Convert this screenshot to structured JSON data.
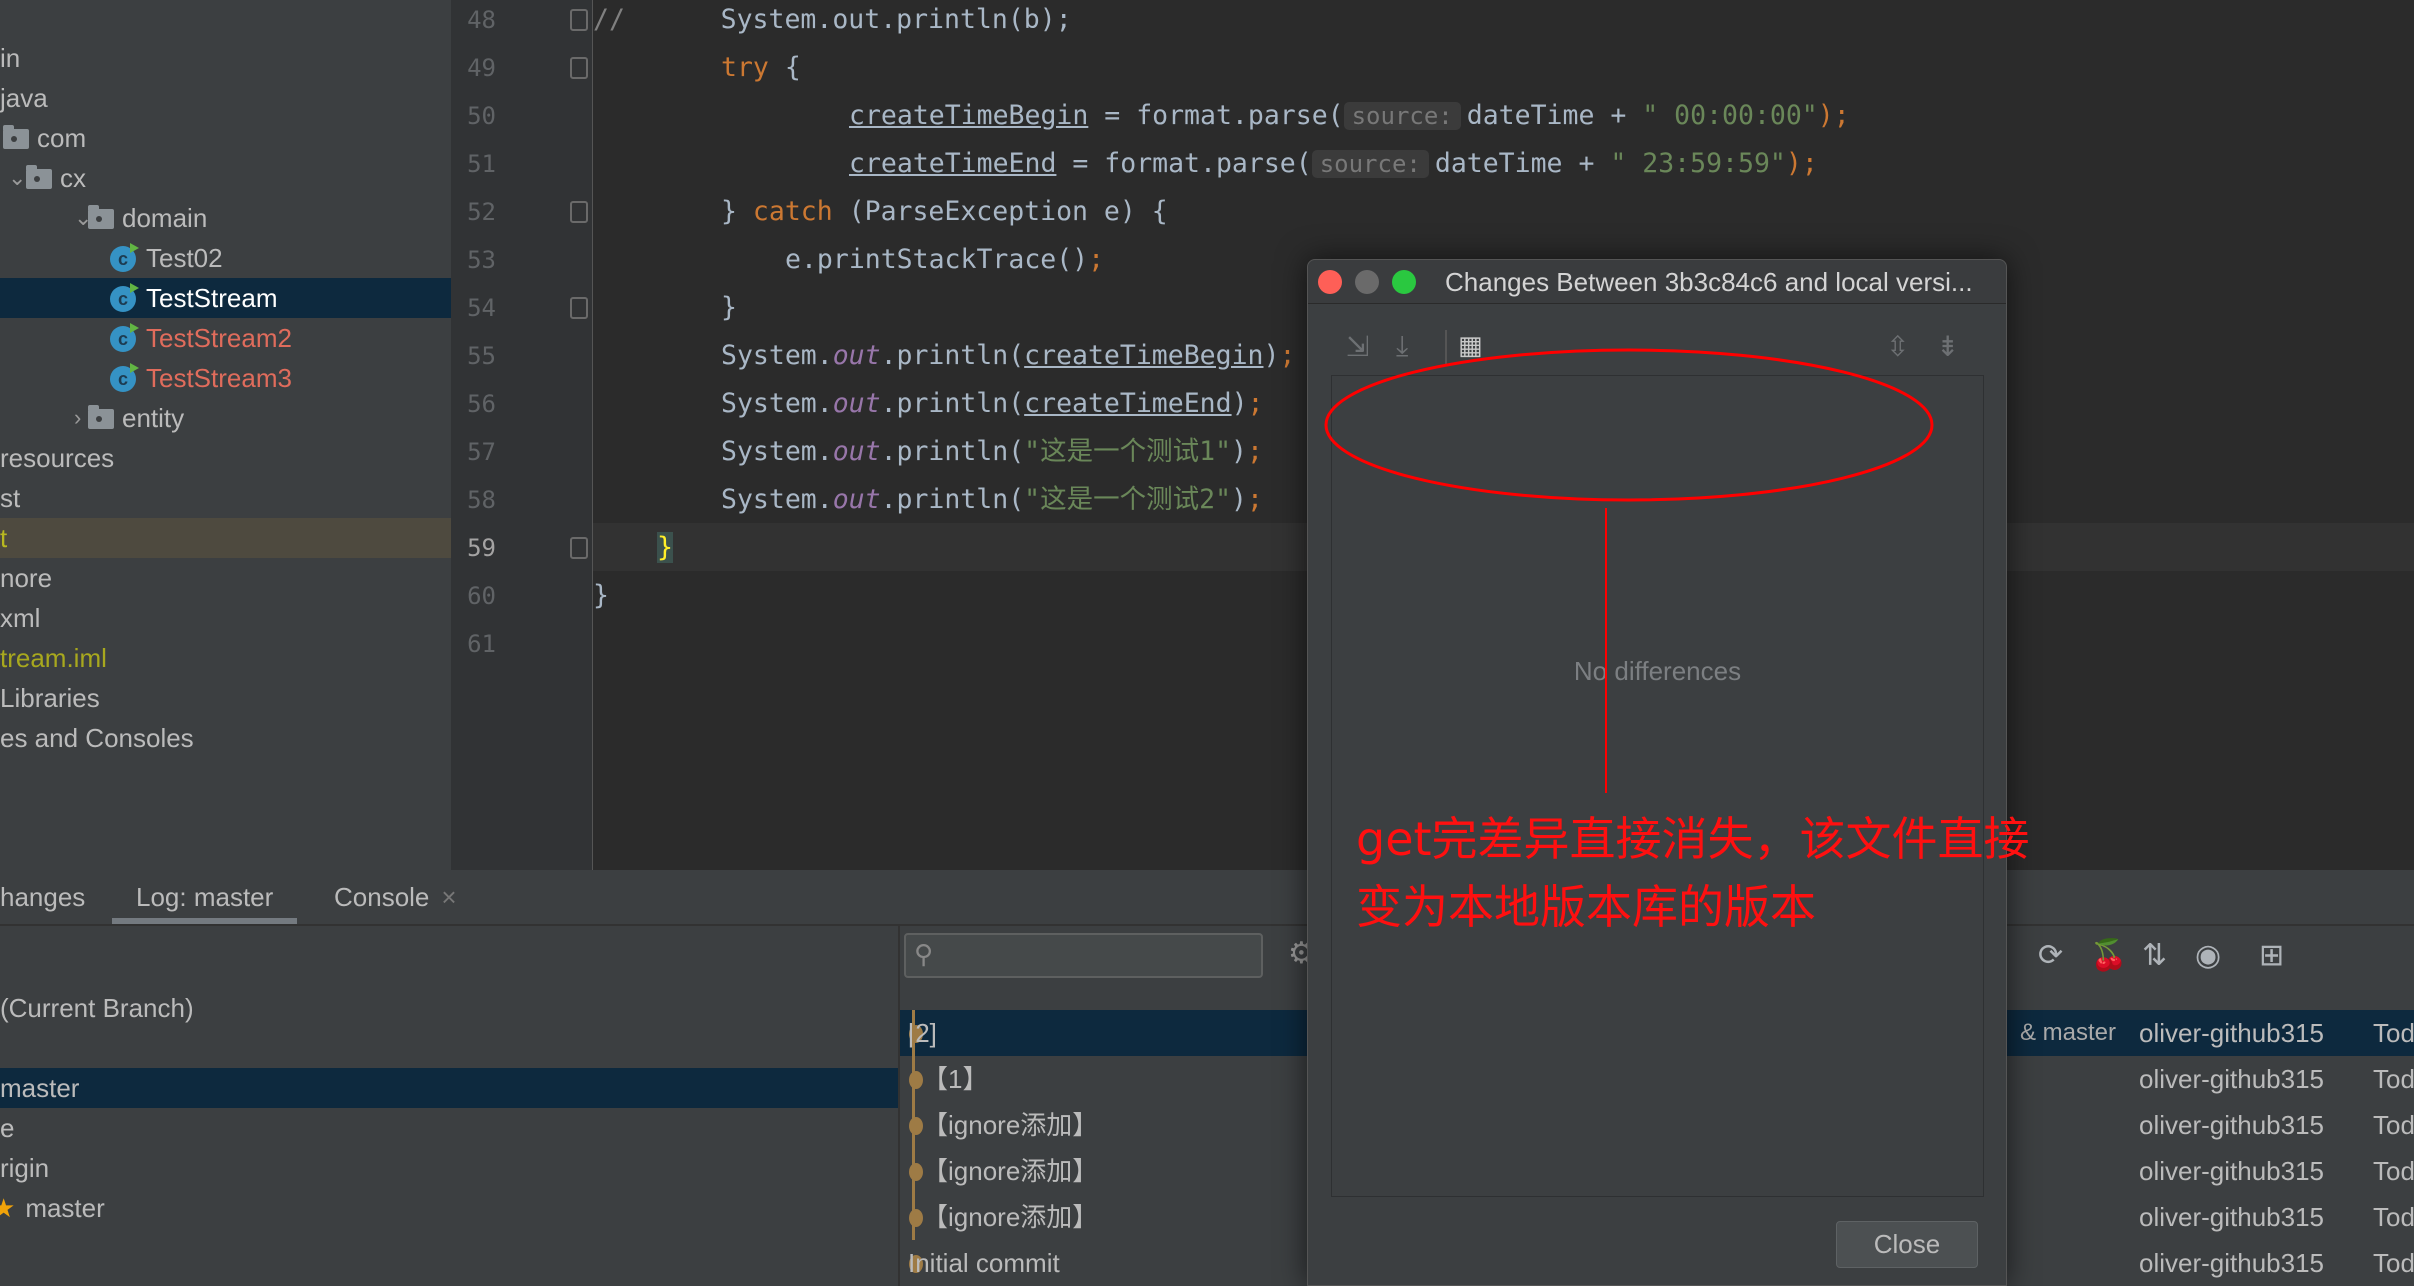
{
  "project_tree": [
    {
      "label": "in",
      "indent": 0,
      "icon": "none",
      "color": "#bbbbbb"
    },
    {
      "label": "java",
      "indent": 0,
      "icon": "none",
      "color": "#bbbbbb"
    },
    {
      "label": "com",
      "indent": 25,
      "icon": "folder-icon",
      "color": "#bbbbbb"
    },
    {
      "label": "cx",
      "indent": 48,
      "icon": "folder-icon",
      "chevron": "expanded",
      "color": "#bbbbbb"
    },
    {
      "label": "domain",
      "indent": 110,
      "icon": "folder-icon",
      "chevron": "expanded",
      "color": "#bbbbbb"
    },
    {
      "label": "Test02",
      "indent": 146,
      "icon": "java-class-icon",
      "color": "#bbbbbb"
    },
    {
      "label": "TestStream",
      "indent": 146,
      "icon": "java-class-icon",
      "color": "#ffffff",
      "selected": true
    },
    {
      "label": "TestStream2",
      "indent": 146,
      "icon": "java-class-icon",
      "color": "#e06c5c"
    },
    {
      "label": "TestStream3",
      "indent": 146,
      "icon": "java-class-icon",
      "color": "#e06c5c"
    },
    {
      "label": "entity",
      "indent": 110,
      "icon": "folder-icon",
      "chevron": "collapsed",
      "color": "#bbbbbb"
    },
    {
      "label": "resources",
      "indent": 0,
      "icon": "none",
      "color": "#bbbbbb"
    },
    {
      "label": "st",
      "indent": 0,
      "icon": "none",
      "color": "#bbbbbb"
    },
    {
      "label": "t",
      "indent": 0,
      "icon": "none",
      "color": "#b8b820",
      "highlighted": true
    },
    {
      "label": "nore",
      "indent": 0,
      "icon": "none",
      "color": "#bbbbbb"
    },
    {
      "label": "xml",
      "indent": 0,
      "icon": "none",
      "color": "#bbbbbb"
    },
    {
      "label": "tream.iml",
      "indent": 0,
      "icon": "none",
      "color": "#a8a81e"
    },
    {
      "label": "Libraries",
      "indent": 0,
      "icon": "none",
      "color": "#bbbbbb"
    },
    {
      "label": "es and Consoles",
      "indent": 0,
      "icon": "none",
      "color": "#bbbbbb"
    }
  ],
  "editor": {
    "current_line": 59,
    "lines": [
      {
        "n": 48,
        "indent": 0,
        "fold": true,
        "tokens": [
          {
            "t": "//",
            "c": "cm"
          },
          {
            "t": "      System.out.println(b);",
            "c": ""
          }
        ]
      },
      {
        "n": 49,
        "indent": 8,
        "fold": true,
        "tokens": [
          {
            "t": "try",
            "c": "kw"
          },
          {
            "t": " {",
            "c": ""
          }
        ]
      },
      {
        "n": 50,
        "indent": 16,
        "tokens": [
          {
            "t": "createTimeBegin",
            "c": "ul"
          },
          {
            "t": " = format.parse(",
            "c": ""
          },
          {
            "t": "source:",
            "c": "hint"
          },
          {
            "t": "dateTime + ",
            "c": ""
          },
          {
            "t": "\" 00:00:00\"",
            "c": "str"
          },
          {
            "t": ");",
            "c": "semi"
          }
        ]
      },
      {
        "n": 51,
        "indent": 16,
        "tokens": [
          {
            "t": "createTimeEnd",
            "c": "ul"
          },
          {
            "t": " = format.parse(",
            "c": ""
          },
          {
            "t": "source:",
            "c": "hint"
          },
          {
            "t": "dateTime + ",
            "c": ""
          },
          {
            "t": "\" 23:59:59\"",
            "c": "str"
          },
          {
            "t": ");",
            "c": "semi"
          }
        ]
      },
      {
        "n": 52,
        "indent": 8,
        "fold": true,
        "tokens": [
          {
            "t": "} ",
            "c": ""
          },
          {
            "t": "catch",
            "c": "kw"
          },
          {
            "t": " (ParseException e) {",
            "c": ""
          }
        ]
      },
      {
        "n": 53,
        "indent": 12,
        "tokens": [
          {
            "t": "e.printStackTrace()",
            "c": ""
          },
          {
            "t": ";",
            "c": "semi"
          }
        ]
      },
      {
        "n": 54,
        "indent": 8,
        "fold": true,
        "tokens": [
          {
            "t": "}",
            "c": ""
          }
        ]
      },
      {
        "n": 55,
        "indent": 8,
        "tokens": [
          {
            "t": "System.",
            "c": ""
          },
          {
            "t": "out",
            "c": "st"
          },
          {
            "t": ".println(",
            "c": ""
          },
          {
            "t": "createTimeBegin",
            "c": "ul"
          },
          {
            "t": ")",
            "c": ""
          },
          {
            "t": ";",
            "c": "semi"
          }
        ]
      },
      {
        "n": 56,
        "indent": 8,
        "tokens": [
          {
            "t": "System.",
            "c": ""
          },
          {
            "t": "out",
            "c": "st"
          },
          {
            "t": ".println(",
            "c": ""
          },
          {
            "t": "createTimeEnd",
            "c": "ul"
          },
          {
            "t": ")",
            "c": ""
          },
          {
            "t": ";",
            "c": "semi"
          }
        ]
      },
      {
        "n": 57,
        "indent": 8,
        "tokens": [
          {
            "t": "System.",
            "c": ""
          },
          {
            "t": "out",
            "c": "st"
          },
          {
            "t": ".println(",
            "c": ""
          },
          {
            "t": "\"这是一个测试1\"",
            "c": "str"
          },
          {
            "t": ")",
            "c": ""
          },
          {
            "t": ";",
            "c": "semi"
          }
        ]
      },
      {
        "n": 58,
        "indent": 8,
        "tokens": [
          {
            "t": "System.",
            "c": ""
          },
          {
            "t": "out",
            "c": "st"
          },
          {
            "t": ".println(",
            "c": ""
          },
          {
            "t": "\"这是一个测试2\"",
            "c": "str"
          },
          {
            "t": ")",
            "c": ""
          },
          {
            "t": ";",
            "c": "semi"
          }
        ]
      },
      {
        "n": 59,
        "indent": 4,
        "fold": true,
        "tokens": [
          {
            "t": "}",
            "c": "brace"
          }
        ]
      },
      {
        "n": 60,
        "indent": 0,
        "tokens": [
          {
            "t": "}",
            "c": ""
          }
        ]
      },
      {
        "n": 61,
        "indent": 0,
        "tokens": []
      }
    ]
  },
  "bottom": {
    "tabs": [
      {
        "label": "hanges",
        "active": false
      },
      {
        "label": "Log: master",
        "active": true
      },
      {
        "label": "Console",
        "active": false,
        "closable": true
      }
    ],
    "close_glyph": "×",
    "branches": [
      {
        "label": "(Current Branch)"
      },
      {
        "label": ""
      },
      {
        "label": "master",
        "selected": true
      },
      {
        "label": "e"
      },
      {
        "label": "rigin"
      },
      {
        "label": "master",
        "star": true
      }
    ],
    "search": {
      "placeholder": "",
      "icon": "search-icon"
    },
    "toolbar_icons": [
      "refresh-icon",
      "cherry-pick-icon",
      "sort-icon",
      "eye-icon",
      "new-tab-icon"
    ],
    "commits": [
      {
        "message": "[2]",
        "refs": "& master",
        "author": "oliver-github315",
        "date": "Tod",
        "selected": true
      },
      {
        "message": "【1】",
        "refs": "",
        "author": "oliver-github315",
        "date": "Tod"
      },
      {
        "message": "【ignore添加】",
        "refs": "",
        "author": "oliver-github315",
        "date": "Tod"
      },
      {
        "message": "【ignore添加】",
        "refs": "",
        "author": "oliver-github315",
        "date": "Tod"
      },
      {
        "message": "【ignore添加】",
        "refs": "",
        "author": "oliver-github315",
        "date": "Tod"
      },
      {
        "message": "Initial commit",
        "refs": "",
        "author": "oliver-github315",
        "date": "Tod"
      }
    ]
  },
  "dialog": {
    "title": "Changes Between 3b3c84c6 and local versi...",
    "empty_text": "No differences",
    "close_label": "Close",
    "toolbar_icons": [
      "compare-icon",
      "download-icon",
      "group-by-icon",
      "expand-all-icon",
      "collapse-all-icon"
    ]
  },
  "annotation": {
    "line1": "get完差异直接消失，该文件直接",
    "line2": "变为本地版本库的版本",
    "color": "#ff0000"
  }
}
